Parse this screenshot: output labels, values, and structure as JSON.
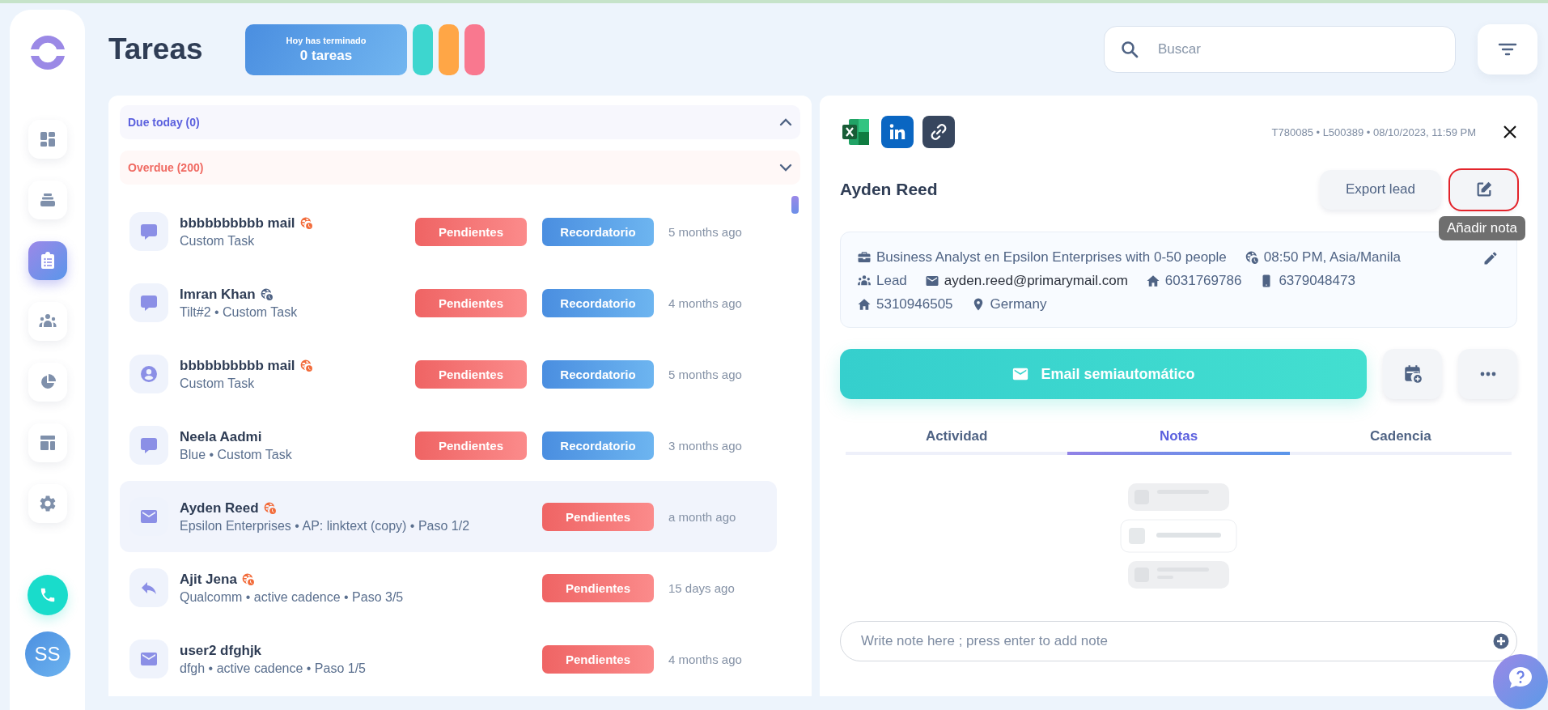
{
  "sidebar": {
    "items": [
      {
        "kind": "dashboard",
        "selected": false
      },
      {
        "kind": "stack",
        "selected": false
      },
      {
        "kind": "clipboard",
        "selected": true
      },
      {
        "kind": "people",
        "selected": false
      },
      {
        "kind": "pie",
        "selected": false
      },
      {
        "kind": "layout",
        "selected": false
      },
      {
        "kind": "gear",
        "selected": false
      }
    ],
    "avatar": {
      "initials": "SS"
    }
  },
  "header": {
    "title": "Tareas",
    "summary": {
      "caption": "Hoy has terminado",
      "count": "0 tareas"
    },
    "color_pills": [
      {
        "color": "#3dd6cf"
      },
      {
        "color": "#ffa646"
      },
      {
        "color": "#f9788f"
      }
    ],
    "search": {
      "placeholder": "Buscar"
    }
  },
  "sections": [
    {
      "label": "Due today (0)",
      "kind": "due",
      "expanded": false
    },
    {
      "label": "Overdue (200)",
      "kind": "overdue",
      "expanded": true
    }
  ],
  "tasks": [
    {
      "kind": "chat",
      "name": "bbbbbbbbbb mail",
      "color": "#f26b3a",
      "subtitle": "Custom Task",
      "tags": [
        {
          "label": "Pendientes",
          "kind": "status"
        },
        {
          "label": "Recordatorio",
          "kind": "reminder"
        }
      ],
      "time": "5 months ago",
      "selected": false
    },
    {
      "kind": "chat",
      "name": "Imran Khan",
      "color": "#4f6384",
      "subtitle": "Tilt#2 • Custom Task",
      "tags": [
        {
          "label": "Pendientes",
          "kind": "status"
        },
        {
          "label": "Recordatorio",
          "kind": "reminder"
        }
      ],
      "time": "4 months ago",
      "selected": false
    },
    {
      "kind": "user",
      "name": "bbbbbbbbbb mail",
      "color": "#f26b3a",
      "subtitle": "Custom Task",
      "tags": [
        {
          "label": "Pendientes",
          "kind": "status"
        },
        {
          "label": "Recordatorio",
          "kind": "reminder"
        }
      ],
      "time": "5 months ago",
      "selected": false
    },
    {
      "kind": "chat",
      "name": "Neela Aadmi",
      "subtitle": "Blue • Custom Task",
      "tags": [
        {
          "label": "Pendientes",
          "kind": "status"
        },
        {
          "label": "Recordatorio",
          "kind": "reminder"
        }
      ],
      "time": "3 months ago",
      "selected": false
    },
    {
      "kind": "mail",
      "name": "Ayden Reed",
      "color": "#f26b3a",
      "subtitle": "Epsilon Enterprises • AP: linktext (copy) • Paso 1/2",
      "tags": [
        {
          "label": "Pendientes",
          "kind": "status"
        }
      ],
      "time": "a month ago",
      "selected": true
    },
    {
      "kind": "reply",
      "name": "Ajit Jena",
      "color": "#f26b3a",
      "subtitle": "Qualcomm • active cadence • Paso 3/5",
      "tags": [
        {
          "label": "Pendientes",
          "kind": "status"
        }
      ],
      "time": "15 days ago",
      "selected": false
    },
    {
      "kind": "mail",
      "name": "user2 dfghjk",
      "subtitle": "dfgh • active cadence • Paso 1/5",
      "tags": [
        {
          "label": "Pendientes",
          "kind": "status"
        }
      ],
      "time": "4 months ago",
      "selected": false
    }
  ],
  "detail": {
    "integrations": [
      {
        "kind": "excel"
      },
      {
        "kind": "linkedin"
      },
      {
        "kind": "link"
      }
    ],
    "meta": "T780085 • L500389 • 08/10/2023, 11:59 PM",
    "name": "Ayden Reed",
    "export_button": "Export lead",
    "note_button": {
      "tooltip": "Añadir nota",
      "highlighted": true
    },
    "info_lines": [
      [
        {
          "kind": "job",
          "text": "Business Analyst en Epsilon Enterprises with 0-50 people"
        },
        {
          "kind": "timezone",
          "text": "08:50 PM, Asia/Manila"
        }
      ],
      [
        {
          "kind": "stage",
          "text": "Lead"
        },
        {
          "kind": "email",
          "text": "ayden.reed@primarymail.com"
        },
        {
          "kind": "phone",
          "text": "6031769786"
        },
        {
          "kind": "mobile",
          "text": "6379048473"
        }
      ],
      [
        {
          "kind": "phone",
          "text": "5310946505"
        },
        {
          "kind": "country",
          "text": "Germany"
        }
      ]
    ],
    "primary_action": {
      "label": "Email semiautomático"
    },
    "tabs": [
      {
        "label": "Actividad",
        "selected": false
      },
      {
        "label": "Notas",
        "selected": true
      },
      {
        "label": "Cadencia",
        "selected": false
      }
    ],
    "note_input": {
      "placeholder": "Write note here ; press enter to add note"
    }
  }
}
